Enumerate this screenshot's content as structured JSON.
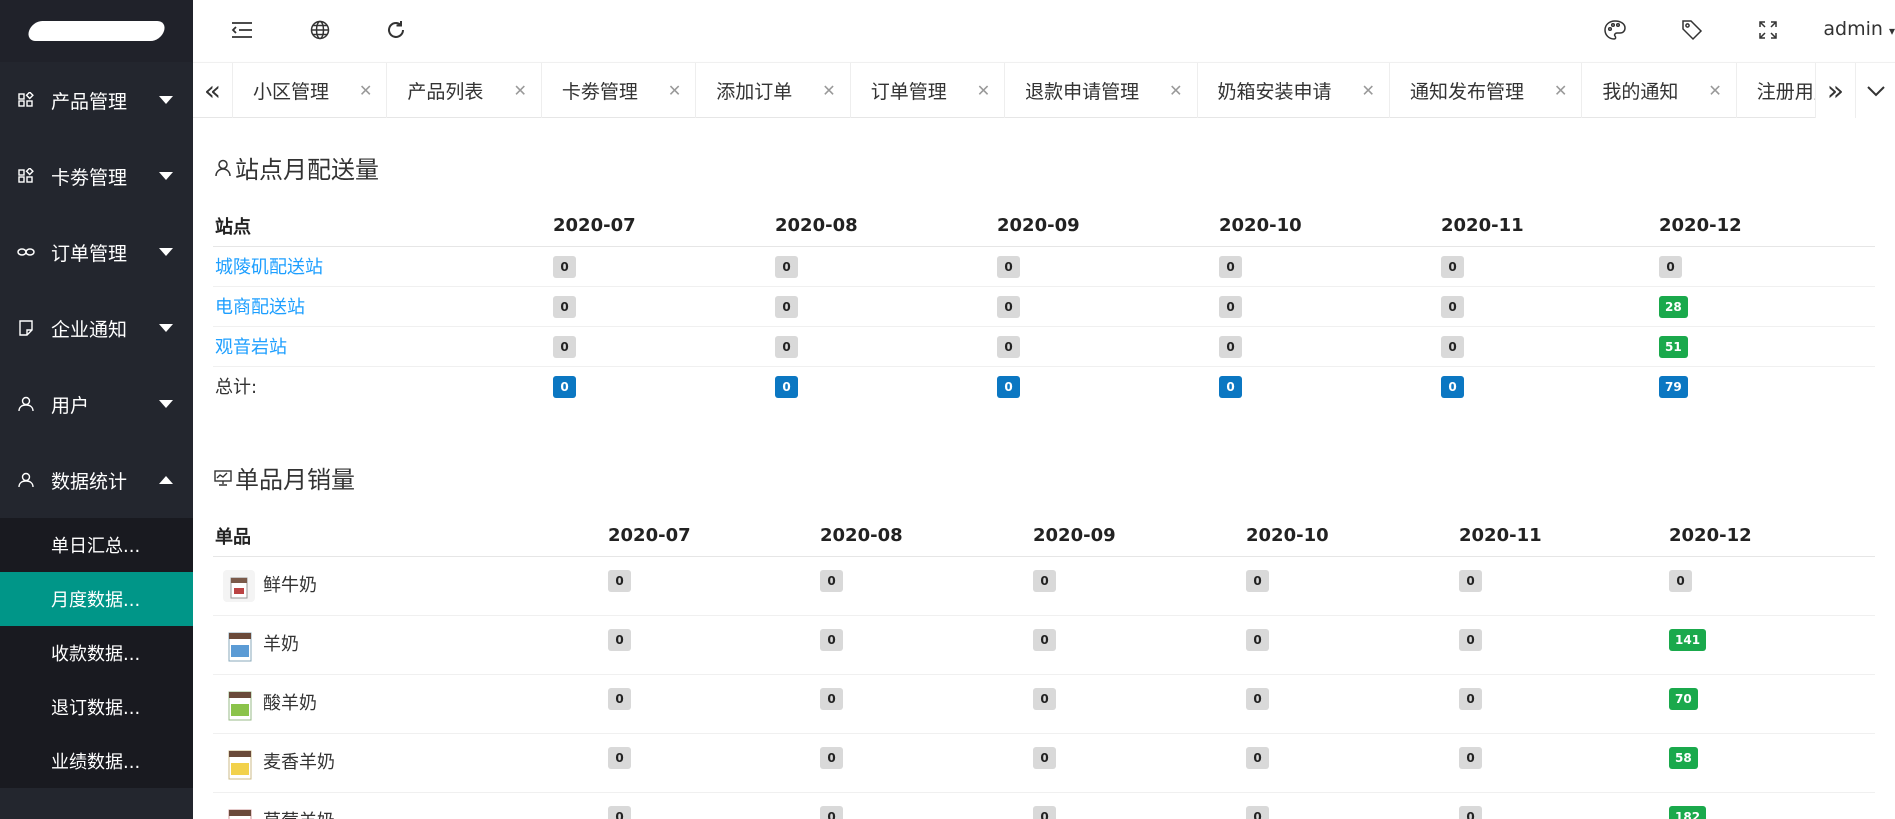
{
  "header": {
    "admin_label": "admin"
  },
  "sidebar": {
    "groups": [
      {
        "label": "产品管理",
        "icon": "apps-icon"
      },
      {
        "label": "卡劵管理",
        "icon": "apps-icon"
      },
      {
        "label": "订单管理",
        "icon": "link-icon"
      },
      {
        "label": "企业通知",
        "icon": "note-icon"
      },
      {
        "label": "用户",
        "icon": "user-icon"
      },
      {
        "label": "数据统计",
        "icon": "user-icon",
        "expanded": true
      }
    ],
    "subitems": [
      {
        "label": "单日汇总..."
      },
      {
        "label": "月度数据...",
        "active": true
      },
      {
        "label": "收款数据..."
      },
      {
        "label": "退订数据..."
      },
      {
        "label": "业绩数据..."
      }
    ]
  },
  "tabs": [
    {
      "label": "小区管理"
    },
    {
      "label": "产品列表"
    },
    {
      "label": "卡劵管理"
    },
    {
      "label": "添加订单"
    },
    {
      "label": "订单管理"
    },
    {
      "label": "退款申请管理"
    },
    {
      "label": "奶箱安装申请"
    },
    {
      "label": "通知发布管理"
    },
    {
      "label": "我的通知"
    },
    {
      "label": "注册用户"
    }
  ],
  "station_section": {
    "title": "站点月配送量",
    "headers": [
      "站点",
      "2020-07",
      "2020-08",
      "2020-09",
      "2020-10",
      "2020-11",
      "2020-12"
    ],
    "rows": [
      {
        "name": "城陵矶配送站",
        "values": [
          "0",
          "0",
          "0",
          "0",
          "0",
          "0"
        ],
        "colors": [
          "gray",
          "gray",
          "gray",
          "gray",
          "gray",
          "gray"
        ]
      },
      {
        "name": "电商配送站",
        "values": [
          "0",
          "0",
          "0",
          "0",
          "0",
          "28"
        ],
        "colors": [
          "gray",
          "gray",
          "gray",
          "gray",
          "gray",
          "green"
        ]
      },
      {
        "name": "观音岩站",
        "values": [
          "0",
          "0",
          "0",
          "0",
          "0",
          "51"
        ],
        "colors": [
          "gray",
          "gray",
          "gray",
          "gray",
          "gray",
          "green"
        ]
      }
    ],
    "total": {
      "label": "总计:",
      "values": [
        "0",
        "0",
        "0",
        "0",
        "0",
        "79"
      ]
    }
  },
  "product_section": {
    "title": "单品月销量",
    "headers": [
      "单品",
      "2020-07",
      "2020-08",
      "2020-09",
      "2020-10",
      "2020-11",
      "2020-12"
    ],
    "rows": [
      {
        "name": "鲜牛奶",
        "values": [
          "0",
          "0",
          "0",
          "0",
          "0",
          "0"
        ],
        "colors": [
          "gray",
          "gray",
          "gray",
          "gray",
          "gray",
          "gray"
        ]
      },
      {
        "name": "羊奶",
        "values": [
          "0",
          "0",
          "0",
          "0",
          "0",
          "141"
        ],
        "colors": [
          "gray",
          "gray",
          "gray",
          "gray",
          "gray",
          "green"
        ]
      },
      {
        "name": "酸羊奶",
        "values": [
          "0",
          "0",
          "0",
          "0",
          "0",
          "70"
        ],
        "colors": [
          "gray",
          "gray",
          "gray",
          "gray",
          "gray",
          "green"
        ]
      },
      {
        "name": "麦香羊奶",
        "values": [
          "0",
          "0",
          "0",
          "0",
          "0",
          "58"
        ],
        "colors": [
          "gray",
          "gray",
          "gray",
          "gray",
          "gray",
          "green"
        ]
      },
      {
        "name": "草莓羊奶",
        "values": [
          "0",
          "0",
          "0",
          "0",
          "0",
          "182"
        ],
        "colors": [
          "gray",
          "gray",
          "gray",
          "gray",
          "gray",
          "green"
        ]
      }
    ]
  },
  "colors": {
    "sidebar_bg": "#23262e",
    "active_green": "#009688",
    "link_blue": "#1e9fff",
    "badge_green": "#1aa94c",
    "badge_blue": "#0b77c2"
  }
}
